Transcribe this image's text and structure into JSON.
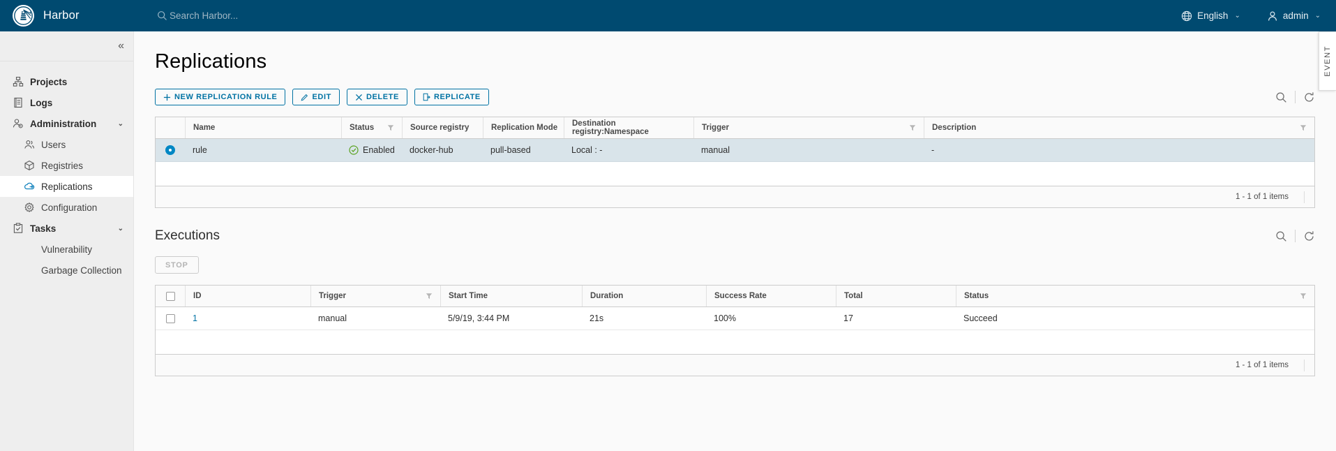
{
  "header": {
    "brand": "Harbor",
    "logo_icon": "harbor-lighthouse-logo",
    "search_icon": "search-icon",
    "search_placeholder": "Search Harbor...",
    "language": "English",
    "language_icon": "globe-icon",
    "user": "admin",
    "user_icon": "user-icon",
    "caret": "⌄"
  },
  "sidebar": {
    "collapse_icon": "«",
    "items": [
      {
        "label": "Projects",
        "icon": "projects-icon",
        "level": "top",
        "active": false,
        "expandable": false
      },
      {
        "label": "Logs",
        "icon": "logs-icon",
        "level": "top",
        "active": false,
        "expandable": false
      },
      {
        "label": "Administration",
        "icon": "administration-icon",
        "level": "top",
        "active": false,
        "expandable": true
      },
      {
        "label": "Users",
        "icon": "users-icon",
        "level": "sub",
        "active": false,
        "expandable": false
      },
      {
        "label": "Registries",
        "icon": "registries-icon",
        "level": "sub",
        "active": false,
        "expandable": false
      },
      {
        "label": "Replications",
        "icon": "replications-icon",
        "level": "sub",
        "active": true,
        "expandable": false
      },
      {
        "label": "Configuration",
        "icon": "configuration-icon",
        "level": "sub",
        "active": false,
        "expandable": false
      },
      {
        "label": "Tasks",
        "icon": "tasks-icon",
        "level": "top",
        "active": false,
        "expandable": true
      },
      {
        "label": "Vulnerability",
        "icon": "",
        "level": "sub",
        "active": false,
        "expandable": false
      },
      {
        "label": "Garbage Collection",
        "icon": "",
        "level": "sub",
        "active": false,
        "expandable": false
      }
    ]
  },
  "main": {
    "page_title": "Replications",
    "buttons": [
      {
        "label": "New Replication Rule",
        "icon": "plus-icon",
        "disabled": false
      },
      {
        "label": "Edit",
        "icon": "pencil-icon",
        "disabled": false
      },
      {
        "label": "Delete",
        "icon": "close-icon",
        "disabled": false
      },
      {
        "label": "Replicate",
        "icon": "replicate-icon",
        "disabled": false
      }
    ],
    "rules_table": {
      "columns": [
        "Name",
        "Status",
        "Source registry",
        "Replication Mode",
        "Destination registry:Namespace",
        "Trigger",
        "Description"
      ],
      "rows": [
        {
          "selected": true,
          "name": "rule",
          "status": "Enabled",
          "status_icon": "check-circle-icon",
          "source_registry": "docker-hub",
          "replication_mode": "pull-based",
          "destination": "Local : -",
          "trigger": "manual",
          "description": "-"
        }
      ],
      "footer": "1 - 1 of 1 items"
    },
    "executions": {
      "title": "Executions",
      "stop_label": "Stop",
      "columns": [
        "ID",
        "Trigger",
        "Start Time",
        "Duration",
        "Success Rate",
        "Total",
        "Status"
      ],
      "rows": [
        {
          "id": "1",
          "trigger": "manual",
          "start_time": "5/9/19, 3:44 PM",
          "duration": "21s",
          "success_rate": "100%",
          "total": "17",
          "status": "Succeed"
        }
      ],
      "footer": "1 - 1 of 1 items"
    },
    "tools": {
      "search_icon": "search-icon",
      "refresh_icon": "refresh-icon"
    }
  },
  "event_tab": {
    "label": "EVENT"
  },
  "colors": {
    "header_bg": "#004a70",
    "accent": "#0072a3",
    "selected_row": "#d9e4ea",
    "sidebar_bg": "#eeeeee",
    "success": "#5aa220"
  }
}
